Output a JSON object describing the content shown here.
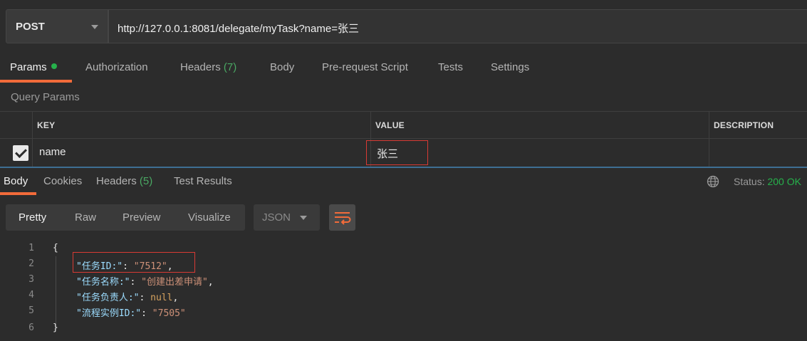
{
  "request": {
    "method": "POST",
    "url": "http://127.0.0.1:8081/delegate/myTask?name=张三"
  },
  "request_tabs": [
    {
      "label": "Params",
      "indicator": "green-dot"
    },
    {
      "label": "Authorization"
    },
    {
      "label": "Headers",
      "count": "(7)"
    },
    {
      "label": "Body"
    },
    {
      "label": "Pre-request Script"
    },
    {
      "label": "Tests"
    },
    {
      "label": "Settings"
    }
  ],
  "query_params": {
    "title": "Query Params",
    "headers": [
      "KEY",
      "VALUE",
      "DESCRIPTION"
    ],
    "rows": [
      {
        "checked": true,
        "key": "name",
        "value": "张三",
        "description": ""
      }
    ]
  },
  "response_tabs": [
    {
      "label": "Body"
    },
    {
      "label": "Cookies"
    },
    {
      "label": "Headers",
      "count": "(5)"
    },
    {
      "label": "Test Results"
    }
  ],
  "status": {
    "label": "Status:",
    "value": "200 OK"
  },
  "view_modes": [
    "Pretty",
    "Raw",
    "Preview",
    "Visualize"
  ],
  "format": "JSON",
  "icons": {
    "globe": "globe-icon",
    "wrap": "wrap-lines-icon",
    "check": "check-icon"
  },
  "colors": {
    "accent": "#f26b3a",
    "status_ok": "#26b14b",
    "highlight_box": "#d83a34"
  },
  "code": {
    "line_numbers": [
      "1",
      "2",
      "3",
      "4",
      "5",
      "6"
    ],
    "lines": [
      {
        "open": "{"
      },
      {
        "key": "\"任务ID:\"",
        "sep": ": ",
        "val": "\"7512\"",
        "type": "s",
        "tail": ","
      },
      {
        "key": "\"任务名称:\"",
        "sep": ": ",
        "val": "\"创建出差申请\"",
        "type": "s",
        "tail": ","
      },
      {
        "key": "\"任务负责人:\"",
        "sep": ": ",
        "val": "null",
        "type": "n",
        "tail": ","
      },
      {
        "key": "\"流程实例ID:\"",
        "sep": ": ",
        "val": "\"7505\"",
        "type": "s",
        "tail": ""
      },
      {
        "close": "}"
      }
    ]
  }
}
